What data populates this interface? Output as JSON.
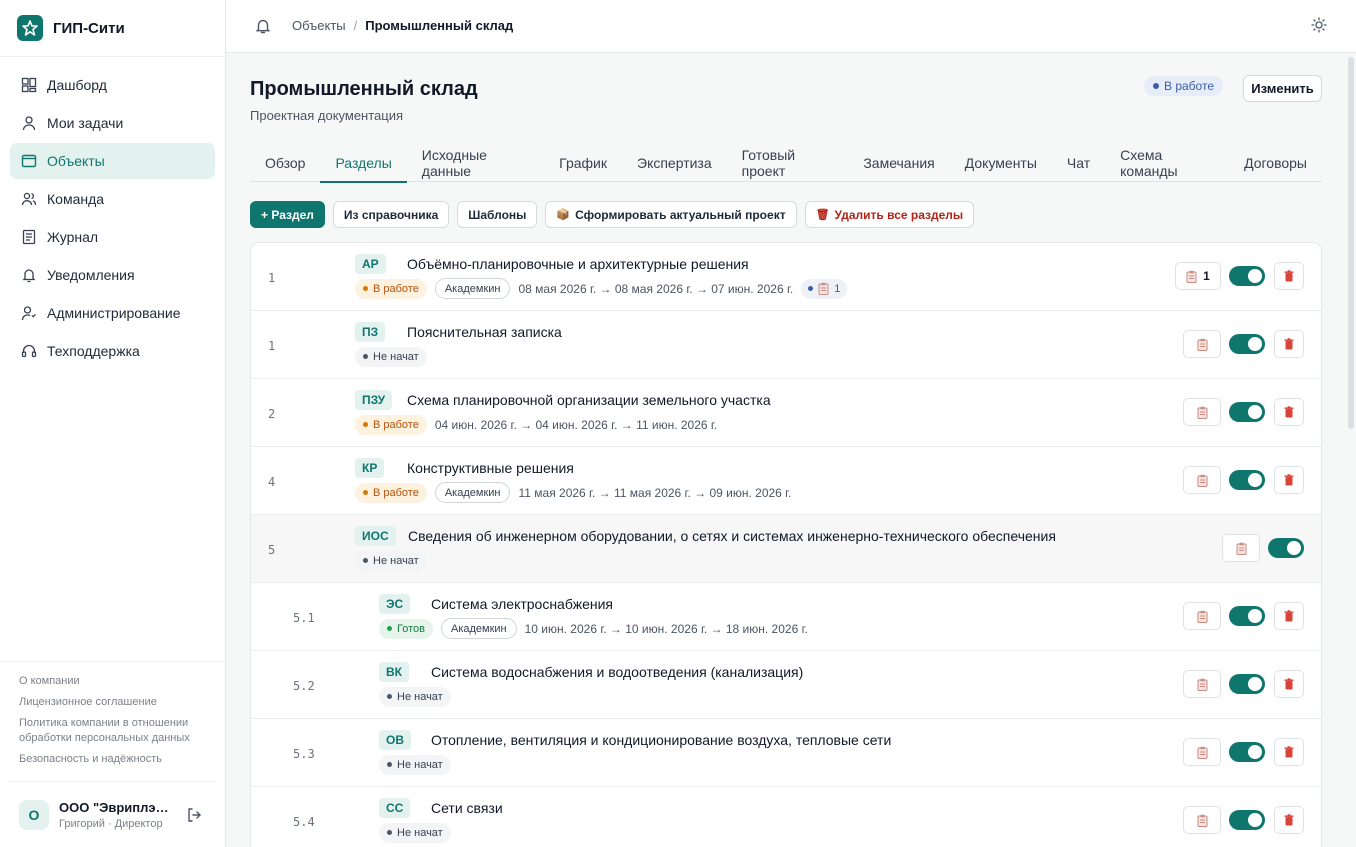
{
  "app": {
    "name": "ГИП-Сити"
  },
  "sidebar": {
    "items": [
      {
        "label": "Дашборд",
        "icon": "dashboard-icon"
      },
      {
        "label": "Мои задачи",
        "icon": "user-icon"
      },
      {
        "label": "Объекты",
        "icon": "folder-icon",
        "active": true
      },
      {
        "label": "Команда",
        "icon": "users-icon"
      },
      {
        "label": "Журнал",
        "icon": "journal-icon"
      },
      {
        "label": "Уведомления",
        "icon": "bell-icon"
      },
      {
        "label": "Администрирование",
        "icon": "admin-icon"
      },
      {
        "label": "Техподдержка",
        "icon": "headset-icon"
      }
    ],
    "links": [
      "О компании",
      "Лицензионное соглашение",
      "Политика компании в отношении обработки персональных данных",
      "Безопасность и надёжность"
    ],
    "user": {
      "initial": "О",
      "name": "ООО \"Эвриплэй...",
      "role": "Григорий · Директор"
    }
  },
  "topbar": {
    "crumb_parent": "Объекты",
    "crumb_sep": "/",
    "crumb_current": "Промышленный склад"
  },
  "page": {
    "title": "Промышленный склад",
    "subtitle": "Проектная документация",
    "status": "В работе",
    "edit_label": "Изменить"
  },
  "tabs": [
    "Обзор",
    "Разделы",
    "Исходные данные",
    "График",
    "Экспертиза",
    "Готовый проект",
    "Замечания",
    "Документы",
    "Чат",
    "Схема команды",
    "Договоры"
  ],
  "active_tab": "Разделы",
  "actions": {
    "add": "+ Раздел",
    "from_catalog": "Из справочника",
    "templates": "Шаблоны",
    "build": "Сформировать актуальный проект",
    "delete_all": "Удалить все разделы"
  },
  "sections": [
    {
      "num": "1",
      "code": "АР",
      "title": "Объёмно-планировочные и архитектурные решения",
      "status": "В работе",
      "executor": "Академкин",
      "dates": "08 мая 2026 г. →  08 мая 2026 г. → 07 июн. 2026 г.",
      "remarks": "1",
      "docs": "1",
      "enabled": true,
      "child": false,
      "deletable": true
    },
    {
      "num": "1",
      "code": "ПЗ",
      "title": "Пояснительная записка",
      "status": "Не начат",
      "executor": "",
      "dates": "",
      "remarks": "",
      "docs": "",
      "enabled": true,
      "child": false,
      "deletable": true
    },
    {
      "num": "2",
      "code": "ПЗУ",
      "title": "Схема планировочной организации земельного участка",
      "status": "В работе",
      "executor": "",
      "dates": "04 июн. 2026 г. →  04 июн. 2026 г. → 11 июн. 2026 г.",
      "remarks": "",
      "docs": "",
      "enabled": true,
      "child": false,
      "deletable": true
    },
    {
      "num": "4",
      "code": "КР",
      "title": "Конструктивные решения",
      "status": "В работе",
      "executor": "Академкин",
      "dates": "11 мая 2026 г. →  11 мая 2026 г. → 09 июн. 2026 г.",
      "remarks": "",
      "docs": "",
      "enabled": true,
      "child": false,
      "deletable": true
    },
    {
      "num": "5",
      "code": "ИОС",
      "title": "Сведения об инженерном оборудовании, о сетях и системах инженерно-технического обеспечения",
      "status": "Не начат",
      "executor": "",
      "dates": "",
      "remarks": "",
      "docs": "",
      "enabled": true,
      "child": false,
      "deletable": false,
      "parent": true
    },
    {
      "num": "5.1",
      "code": "ЭС",
      "title": "Система электроснабжения",
      "status": "Готов",
      "executor": "Академкин",
      "dates": "10 июн. 2026 г. →  10 июн. 2026 г. → 18 июн. 2026 г.",
      "remarks": "",
      "docs": "",
      "enabled": true,
      "child": true,
      "deletable": true
    },
    {
      "num": "5.2",
      "code": "ВК",
      "title": "Система водоснабжения и водоотведения (канализация)",
      "status": "Не начат",
      "executor": "",
      "dates": "",
      "remarks": "",
      "docs": "",
      "enabled": true,
      "child": true,
      "deletable": true
    },
    {
      "num": "5.3",
      "code": "ОВ",
      "title": "Отопление, вентиляция и кондиционирование воздуха, тепловые сети",
      "status": "Не начат",
      "executor": "",
      "dates": "",
      "remarks": "",
      "docs": "",
      "enabled": true,
      "child": true,
      "deletable": true
    },
    {
      "num": "5.4",
      "code": "СС",
      "title": "Сети связи",
      "status": "Не начат",
      "executor": "",
      "dates": "",
      "remarks": "",
      "docs": "",
      "enabled": true,
      "child": true,
      "deletable": true
    }
  ],
  "colors": {
    "accent": "#0f766e",
    "accent_soft": "#e3f1ef",
    "work": "#d97706",
    "ready": "#16a34a",
    "info": "#3b5ea8",
    "danger": "#b42318"
  }
}
